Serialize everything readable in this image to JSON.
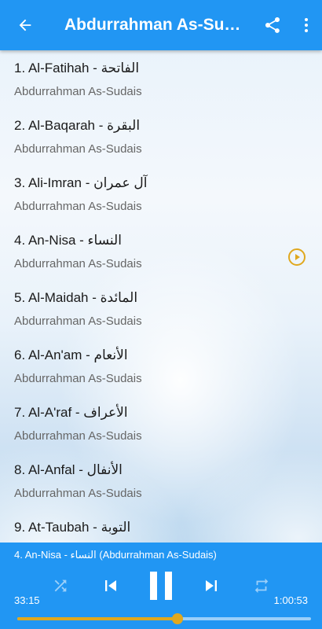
{
  "appbar": {
    "title": "Abdurrahman As-Sudais"
  },
  "reciter": "Abdurrahman As-Sudais",
  "surahs": [
    {
      "title": "1. Al-Fatihah - الفاتحة",
      "subtitle": "Abdurrahman As-Sudais",
      "playing": false
    },
    {
      "title": "2. Al-Baqarah - البقرة",
      "subtitle": "Abdurrahman As-Sudais",
      "playing": false
    },
    {
      "title": "3. Ali-Imran - آل عمران",
      "subtitle": "Abdurrahman As-Sudais",
      "playing": false
    },
    {
      "title": "4. An-Nisa - النساء",
      "subtitle": "Abdurrahman As-Sudais",
      "playing": true
    },
    {
      "title": "5. Al-Maidah - المائدة",
      "subtitle": "Abdurrahman As-Sudais",
      "playing": false
    },
    {
      "title": "6. Al-An'am - الأنعام",
      "subtitle": "Abdurrahman As-Sudais",
      "playing": false
    },
    {
      "title": "7. Al-A'raf - الأعراف",
      "subtitle": "Abdurrahman As-Sudais",
      "playing": false
    },
    {
      "title": "8. Al-Anfal - الأنفال",
      "subtitle": "Abdurrahman As-Sudais",
      "playing": false
    },
    {
      "title": "9. At-Taubah - التوبة",
      "subtitle": "Abdurrahman As-Sudais",
      "playing": false
    }
  ],
  "player": {
    "now_playing": "4. An-Nisa - النساء (Abdurrahman As-Sudais)",
    "elapsed": "33:15",
    "duration": "1:00:53",
    "progress": 0.546
  },
  "colors": {
    "primary": "#2196f3",
    "accent": "#e0a81e"
  },
  "icons": [
    "back-arrow-icon",
    "share-icon",
    "more-vert-icon",
    "play-circle-icon",
    "shuffle-icon",
    "skip-previous-icon",
    "pause-icon",
    "skip-next-icon",
    "repeat-icon"
  ]
}
